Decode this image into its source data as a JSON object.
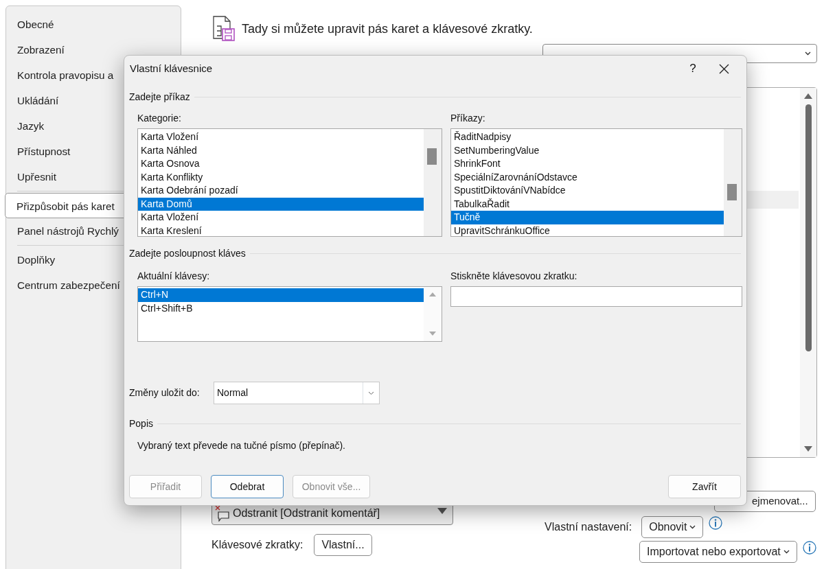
{
  "sidebar": {
    "items": [
      {
        "label": "Obecné",
        "selected": false,
        "divider_after": false
      },
      {
        "label": "Zobrazení",
        "selected": false,
        "divider_after": false
      },
      {
        "label": "Kontrola pravopisu a",
        "selected": false,
        "divider_after": false
      },
      {
        "label": "Ukládání",
        "selected": false,
        "divider_after": false
      },
      {
        "label": "Jazyk",
        "selected": false,
        "divider_after": false
      },
      {
        "label": "Přístupnost",
        "selected": false,
        "divider_after": false
      },
      {
        "label": "Upřesnit",
        "selected": false,
        "divider_after": true
      },
      {
        "label": "Přizpůsobit pás karet",
        "selected": true,
        "divider_after": false
      },
      {
        "label": "Panel nástrojů Rychlý",
        "selected": false,
        "divider_after": true
      },
      {
        "label": "Doplňky",
        "selected": false,
        "divider_after": false
      },
      {
        "label": "Centrum zabezpečení",
        "selected": false,
        "divider_after": false
      }
    ]
  },
  "header": {
    "text": "Tady si můžete upravit pás karet a klávesové zkratky."
  },
  "commands_box": {
    "item": "Odstranit [Odstranit komentář]"
  },
  "shortcuts": {
    "label": "Klávesové zkratky:",
    "button": "Vlastní..."
  },
  "tab_buttons": [
    "ejmenovat..."
  ],
  "custom": {
    "label": "Vlastní nastavení:",
    "reset_button": "Obnovit",
    "import_export_button": "Importovat nebo exportovat"
  },
  "dialog": {
    "title": "Vlastní klávesnice",
    "help": "?",
    "command_section": "Zadejte příkaz",
    "categories": {
      "label": "Kategorie:",
      "items": [
        {
          "label": "Karta Vložení",
          "selected": false
        },
        {
          "label": "Karta Náhled",
          "selected": false
        },
        {
          "label": "Karta Osnova",
          "selected": false
        },
        {
          "label": "Karta Konflikty",
          "selected": false
        },
        {
          "label": "Karta Odebrání pozadí",
          "selected": false
        },
        {
          "label": "Karta Domů",
          "selected": true
        },
        {
          "label": "Karta Vložení",
          "selected": false
        },
        {
          "label": "Karta Kreslení",
          "selected": false
        }
      ]
    },
    "commands": {
      "label": "Příkazy:",
      "items": [
        {
          "label": "ŘaditNadpisy",
          "selected": false
        },
        {
          "label": "SetNumberingValue",
          "selected": false
        },
        {
          "label": "ShrinkFont",
          "selected": false
        },
        {
          "label": "SpeciálníZarovnáníOdstavce",
          "selected": false
        },
        {
          "label": "SpustitDiktováníVNabídce",
          "selected": false
        },
        {
          "label": "TabulkaŘadit",
          "selected": false
        },
        {
          "label": "Tučně",
          "selected": true
        },
        {
          "label": "UpravitSchránkuOffice",
          "selected": false
        }
      ]
    },
    "keys_section": "Zadejte posloupnost kláves",
    "current_keys": {
      "label": "Aktuální klávesy:",
      "items": [
        {
          "label": "Ctrl+N",
          "selected": true
        },
        {
          "label": "Ctrl+Shift+B",
          "selected": false
        }
      ]
    },
    "new_key": {
      "label": "Stiskněte klávesovou zkratku:"
    },
    "save_in": {
      "label": "Změny uložit do:",
      "value": "Normal"
    },
    "description_section": "Popis",
    "description": "Vybraný text převede na tučné písmo (přepínač).",
    "buttons": [
      {
        "label": "Přiřadit",
        "disabled": true,
        "focused": false
      },
      {
        "label": "Odebrat",
        "disabled": false,
        "focused": true
      },
      {
        "label": "Obnovit vše...",
        "disabled": true,
        "focused": false
      }
    ],
    "close_button": "Zavřít"
  }
}
